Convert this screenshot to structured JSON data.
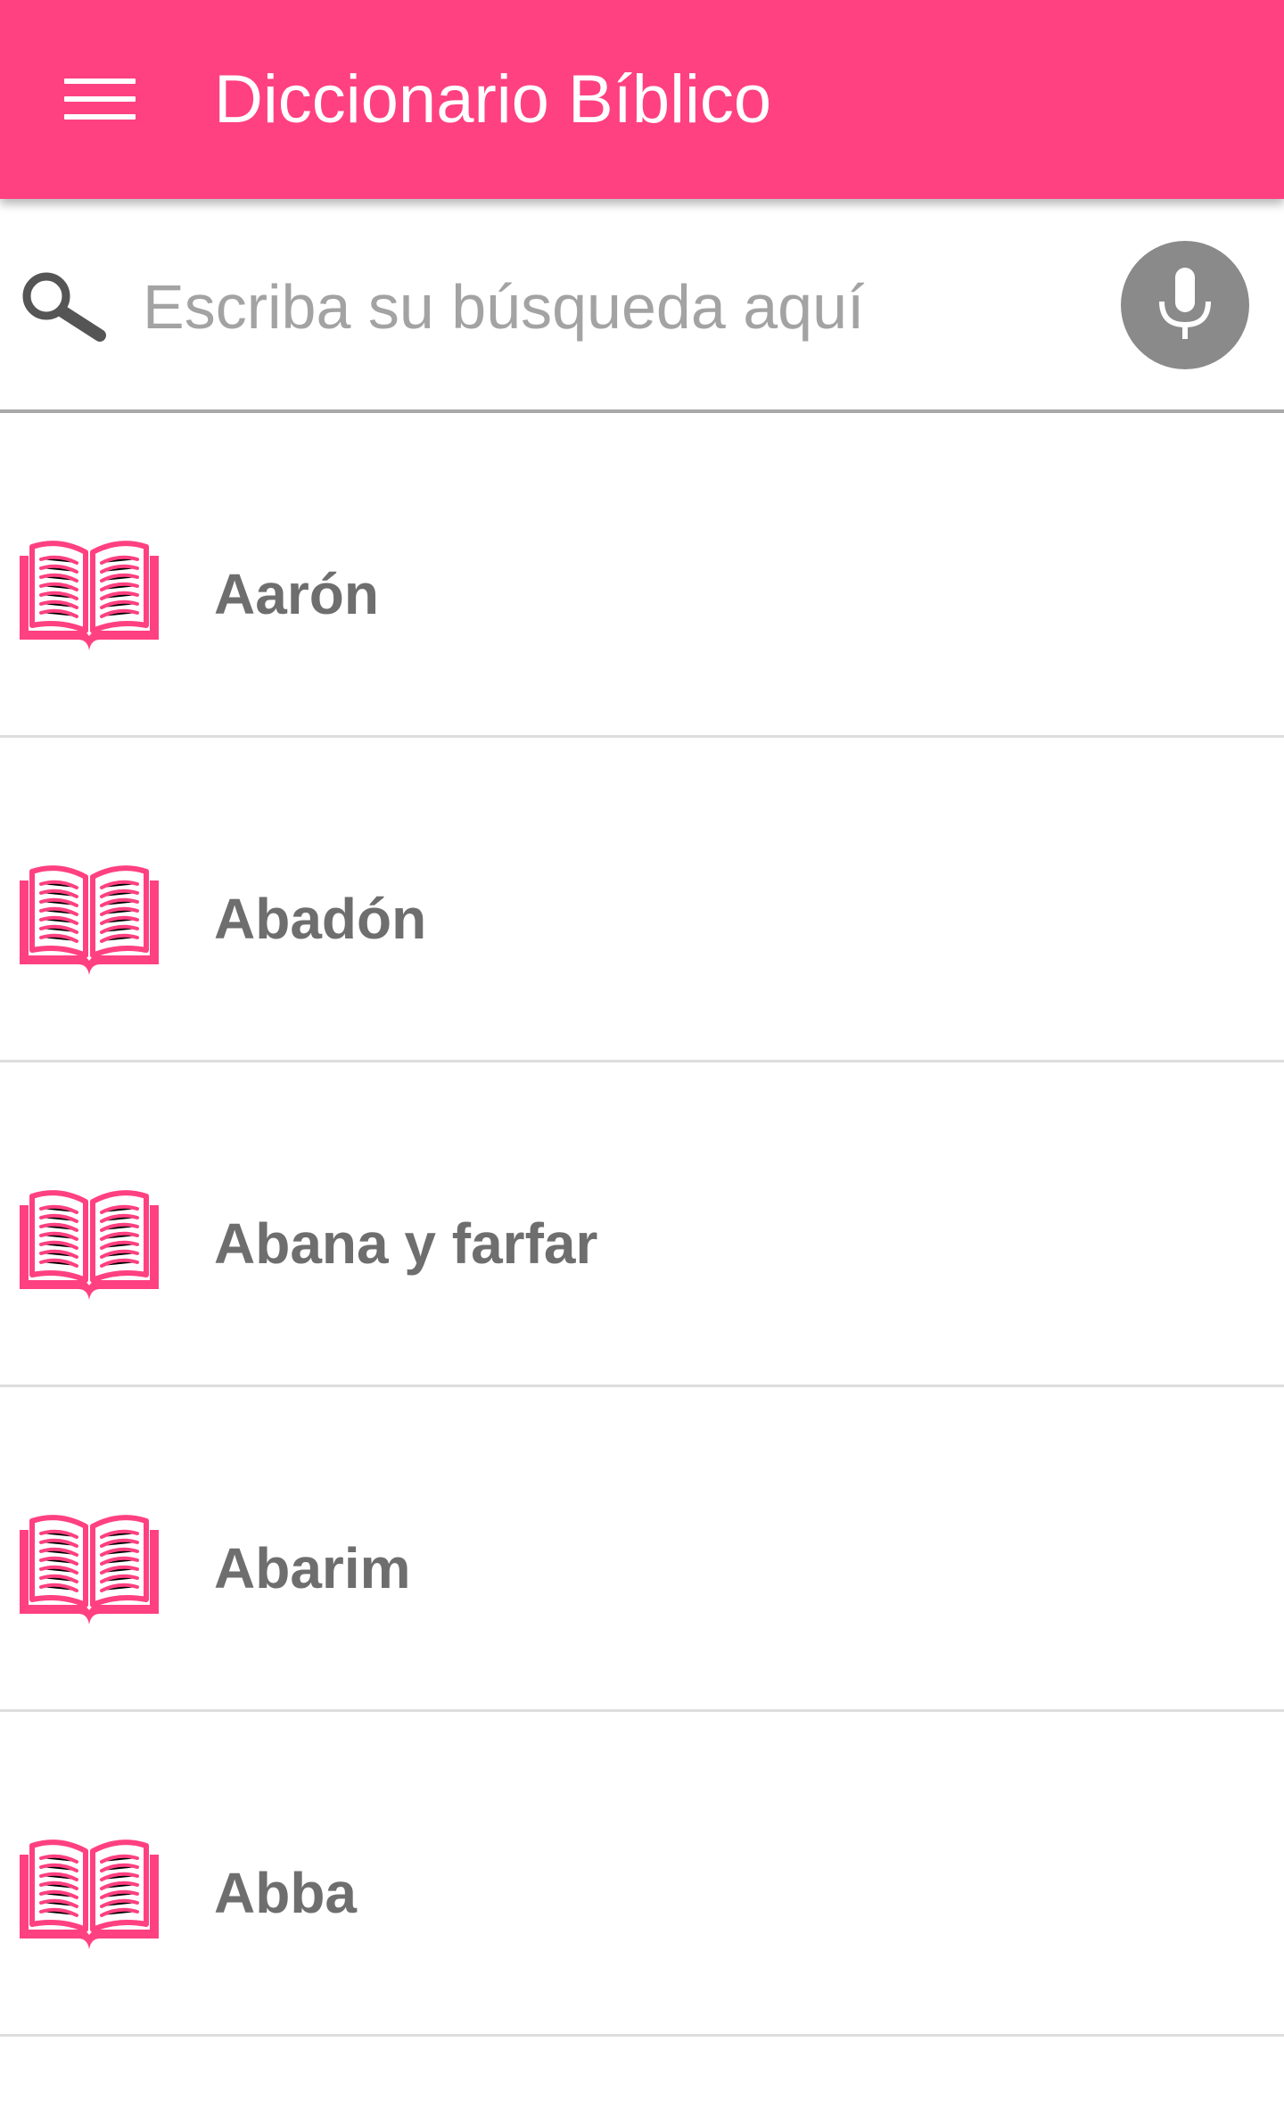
{
  "app": {
    "title": "Diccionario Bíblico",
    "accent_color": "#ff4081"
  },
  "header": {
    "menu_icon": "hamburger-menu-icon"
  },
  "search": {
    "icon": "search-icon",
    "placeholder": "Escriba su búsqueda aquí",
    "value": "",
    "mic_icon": "microphone-icon"
  },
  "list": {
    "item_icon": "open-book-icon",
    "items": [
      {
        "label": "Aarón"
      },
      {
        "label": "Abadón"
      },
      {
        "label": "Abana y farfar"
      },
      {
        "label": "Abarim"
      },
      {
        "label": "Abba"
      }
    ]
  }
}
